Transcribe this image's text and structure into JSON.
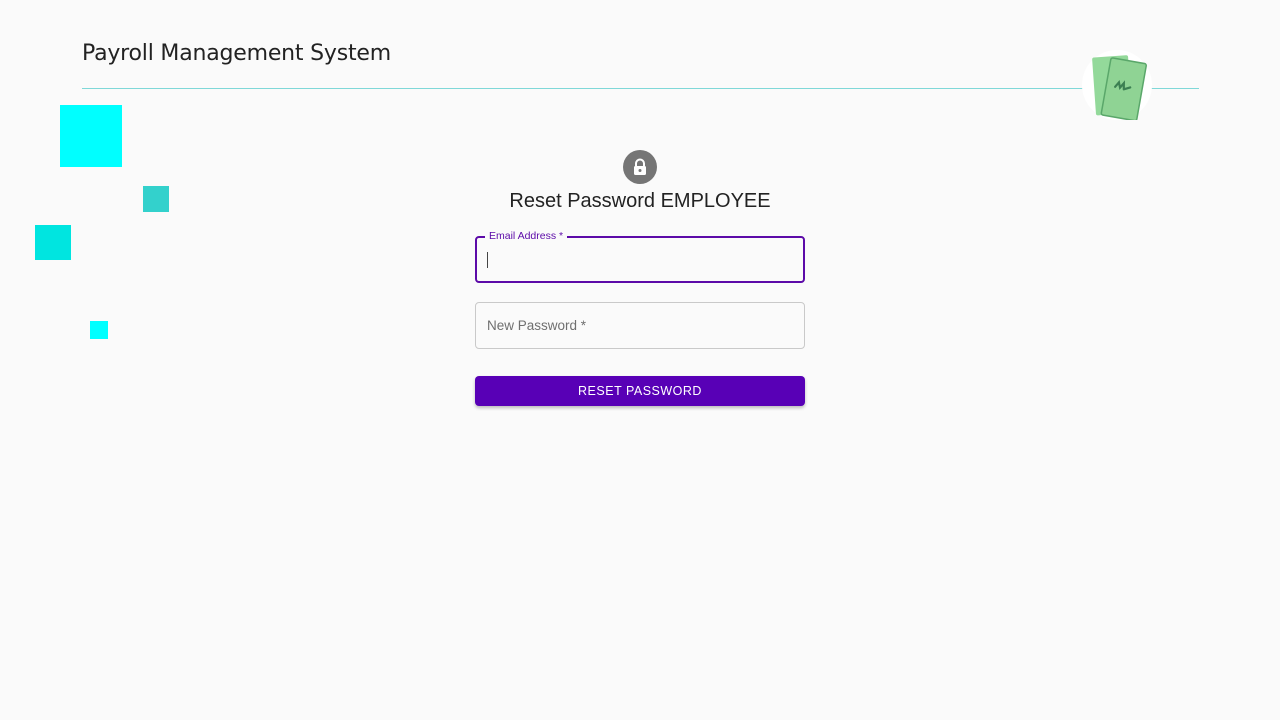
{
  "header": {
    "app_title": "Payroll Management System",
    "logo_icon": "money-bills-icon"
  },
  "form": {
    "title": "Reset Password EMPLOYEE",
    "lock_icon": "lock-icon",
    "email": {
      "label": "Email Address *",
      "value": ""
    },
    "new_password": {
      "label": "New Password *",
      "value": ""
    },
    "submit_label": "RESET PASSWORD"
  },
  "colors": {
    "background": "#fafafa",
    "accent": "#5800b6",
    "decor_cyan": "#00ffff",
    "decor_teal": "#33d1cc",
    "rule": "#7fd8d8"
  }
}
